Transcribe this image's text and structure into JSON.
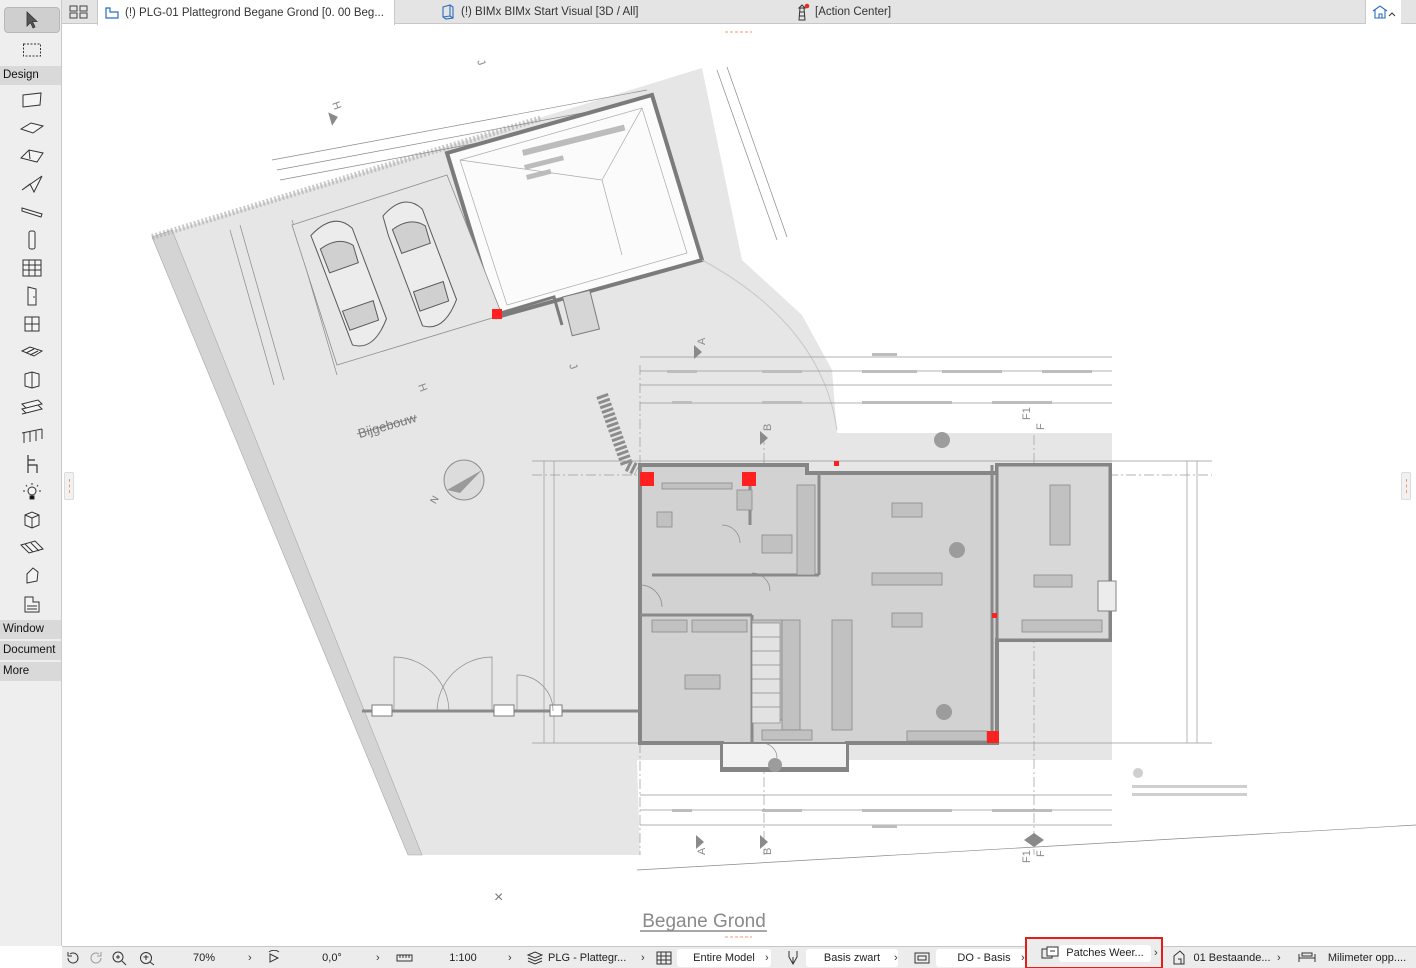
{
  "tabs": [
    {
      "label": "(!) PLG-01 Plattegrond Begane Grond [0. 00 Beg..."
    },
    {
      "label": "(!) BIMx BIMx Start Visual [3D / All]"
    },
    {
      "label": "[Action Center]"
    }
  ],
  "toolbox": {
    "groups": {
      "design": "Design",
      "window": "Window",
      "document": "Document",
      "more": "More"
    }
  },
  "drawing": {
    "title": "Begane Grond",
    "annex_label": "Bijgebouw",
    "north_label": "N",
    "axis_labels": {
      "a_top": "A",
      "b_top": "B",
      "f1_top": "F1",
      "f_top": "F",
      "a_bottom": "A",
      "b_bottom": "B",
      "f1_bottom": "F1",
      "f_bottom": "F",
      "h_top": "H",
      "j_top": "J",
      "h_mid": "H",
      "j_mid": "J"
    },
    "close_glyph": "×"
  },
  "statusbar": {
    "zoom": "70%",
    "angle": "0,0°",
    "scale": "1:100",
    "layer_combo": "PLG - Plattegr...",
    "model_view": "Entire Model",
    "pen_set": "Basis zwart",
    "graphic_override": "DO - Basis",
    "renovation_filter": "Patches Weer...",
    "structure_display": "01 Bestaande...",
    "dimension_std": "Milimeter opp...."
  },
  "colors": {
    "highlight": "#e0201b",
    "canvas_fill": "#e6e6e6",
    "building_fill": "#d2d2d2",
    "wall": "#8c8c8c",
    "marker_red": "#ff2020"
  }
}
